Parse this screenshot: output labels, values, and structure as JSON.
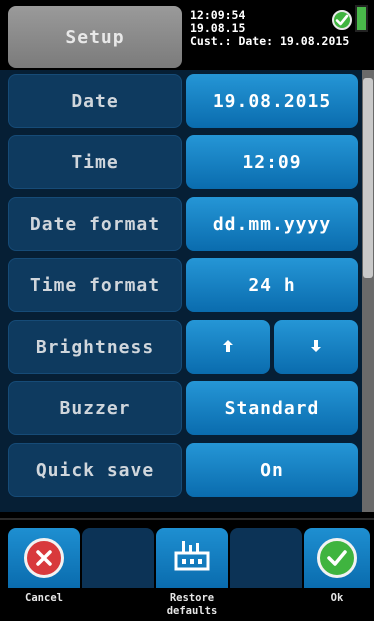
{
  "header": {
    "title": "Setup",
    "status_time": "12:09:54",
    "status_date": "19.08.15",
    "status_cust": "Cust.: Date: 19.08.2015",
    "status_icon": "check-circle-icon",
    "battery_icon": "battery-icon"
  },
  "settings": {
    "date": {
      "label": "Date",
      "value": "19.08.2015"
    },
    "time": {
      "label": "Time",
      "value": "12:09"
    },
    "date_format": {
      "label": "Date format",
      "value": "dd.mm.yyyy"
    },
    "time_format": {
      "label": "Time format",
      "value": "24 h"
    },
    "brightness": {
      "label": "Brightness",
      "up_icon": "arrow-up-icon",
      "down_icon": "arrow-down-icon"
    },
    "buzzer": {
      "label": "Buzzer",
      "value": "Standard"
    },
    "quick_save": {
      "label": "Quick save",
      "value": "On"
    }
  },
  "footer": {
    "cancel_label": "Cancel",
    "restore_label_line1": "Restore",
    "restore_label_line2": "defaults",
    "ok_label": "Ok"
  },
  "colors": {
    "panel_bg": "#061f35",
    "label_bg": "#0e3a5f",
    "button_blue": "#1a82c4",
    "cancel_red": "#d8393c",
    "ok_green": "#3fb43f"
  }
}
